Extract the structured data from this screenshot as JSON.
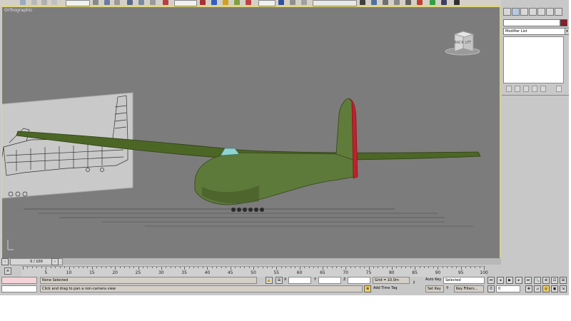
{
  "viewport": {
    "label": "Orthographic",
    "viewcube": {
      "left_face": "BACK",
      "right_face": "LFT"
    }
  },
  "command_panel": {
    "modifier_list": "Modifier List",
    "color": "#8a1c2c"
  },
  "time_slider": {
    "label": "0 / 100"
  },
  "track_ticks": [
    "5",
    "10",
    "15",
    "20",
    "25",
    "30",
    "35",
    "40",
    "45",
    "50",
    "55",
    "60",
    "65",
    "70",
    "75",
    "80",
    "85",
    "90",
    "95",
    "100"
  ],
  "status": {
    "selection": "None Selected",
    "prompt": "Click and drag to pan a non-camera view",
    "x_label": "X",
    "y_label": "Y",
    "z_label": "Z",
    "grid": "Grid = 10.0m",
    "add_time_tag": "Add Time Tag",
    "auto_key": "Auto Key",
    "key_mode": "Selected",
    "set_key": "Set Key",
    "key_filters": "Key Filters...",
    "frame": "0"
  },
  "colors": {
    "viewport_bg": "#7c7c7c",
    "viewport_border": "#e8dc4e",
    "glider": "#5e7a3a",
    "rudder": "#c0202c",
    "canopy": "#8fd4d0"
  }
}
